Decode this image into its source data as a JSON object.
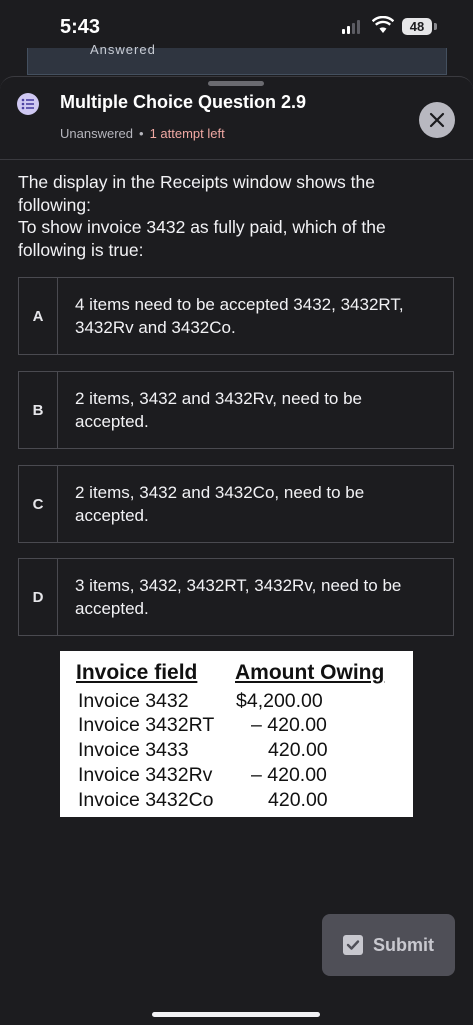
{
  "status_bar": {
    "time": "5:43",
    "battery": "48"
  },
  "underlay": {
    "text": "Answered"
  },
  "header": {
    "title": "Multiple Choice Question 2.9",
    "status": "Unanswered",
    "separator": "•",
    "attempts": "1 attempt left"
  },
  "question": {
    "line1": "The display in the Receipts window shows the following:",
    "line2": "To show invoice 3432 as fully paid, which of the following is true:"
  },
  "options": [
    {
      "letter": "A",
      "text": "4 items need to be accepted 3432, 3432RT, 3432Rv and 3432Co."
    },
    {
      "letter": "B",
      "text": "2 items, 3432 and 3432Rv, need to be accepted."
    },
    {
      "letter": "C",
      "text": "2 items, 3432 and 3432Co, need to be accepted."
    },
    {
      "letter": "D",
      "text": "3 items, 3432, 3432RT, 3432Rv, need to be accepted."
    }
  ],
  "invoice_table": {
    "headers": [
      "Invoice field",
      "Amount Owing"
    ],
    "rows": [
      [
        "Invoice 3432",
        "$4,200.00"
      ],
      [
        "Invoice 3432RT",
        "– 420.00"
      ],
      [
        "Invoice 3433",
        "420.00"
      ],
      [
        "Invoice 3432Rv",
        "– 420.00"
      ],
      [
        "Invoice 3432Co",
        "420.00"
      ]
    ]
  },
  "submit": {
    "label": "Submit"
  },
  "colors": {
    "accent": "#cfc8f2",
    "attempt": "#f0a8a3",
    "button": "#4f4f57"
  }
}
